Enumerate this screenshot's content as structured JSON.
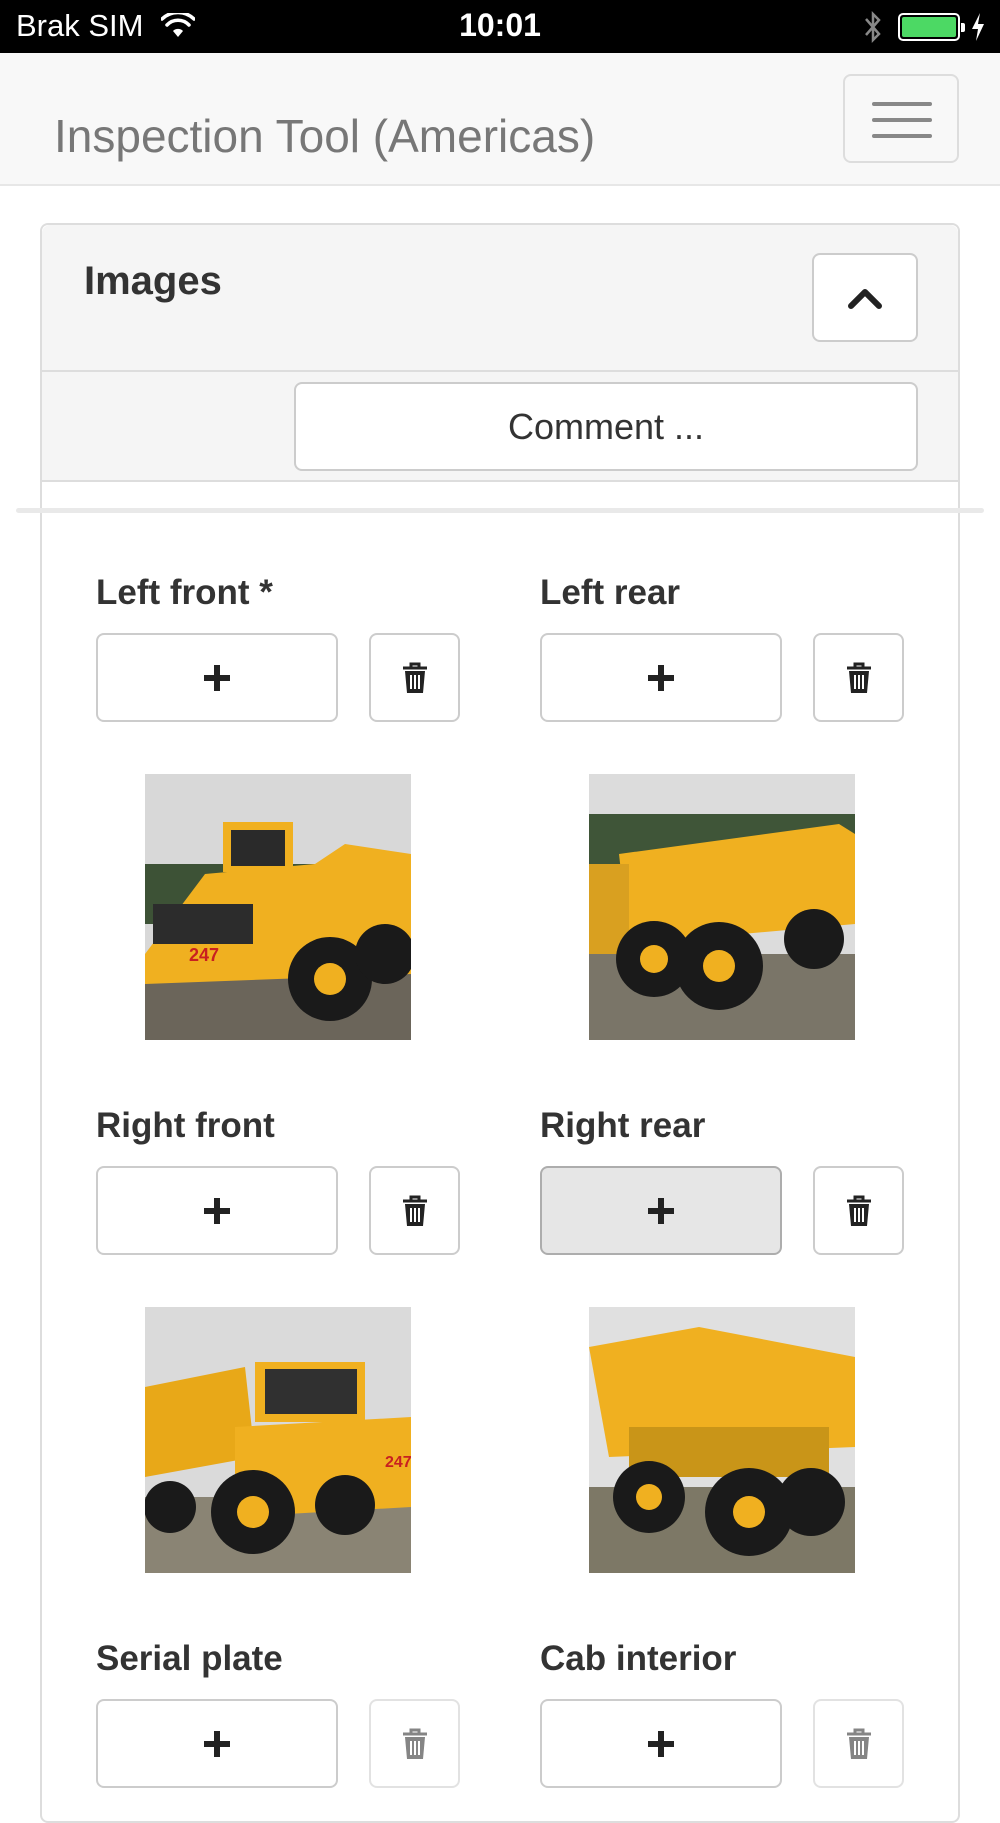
{
  "status_bar": {
    "carrier": "Brak SIM",
    "time": "10:01",
    "battery_level": 1.0
  },
  "navbar": {
    "brand": "Inspection Tool (Americas)",
    "menu_icon": "hamburger-icon"
  },
  "panel": {
    "title": "Images",
    "collapse_icon": "chevron-up-icon",
    "comment_label": "Comment ..."
  },
  "slots": [
    {
      "label": "Left front *",
      "add_icon": "plus-icon",
      "delete_icon": "trash-icon",
      "has_image": true
    },
    {
      "label": "Left rear",
      "add_icon": "plus-icon",
      "delete_icon": "trash-icon",
      "has_image": true
    },
    {
      "label": "Right front",
      "add_icon": "plus-icon",
      "delete_icon": "trash-icon",
      "has_image": true
    },
    {
      "label": "Right rear",
      "add_icon": "plus-icon",
      "delete_icon": "trash-icon",
      "has_image": true,
      "active": true
    },
    {
      "label": "Serial plate",
      "add_icon": "plus-icon",
      "delete_icon": "trash-icon",
      "has_image": false
    },
    {
      "label": "Cab interior",
      "add_icon": "plus-icon",
      "delete_icon": "trash-icon",
      "has_image": false
    }
  ],
  "colors": {
    "truck_yellow": "#f0b020",
    "battery_green": "#4cd964",
    "brand_text": "#777777"
  }
}
